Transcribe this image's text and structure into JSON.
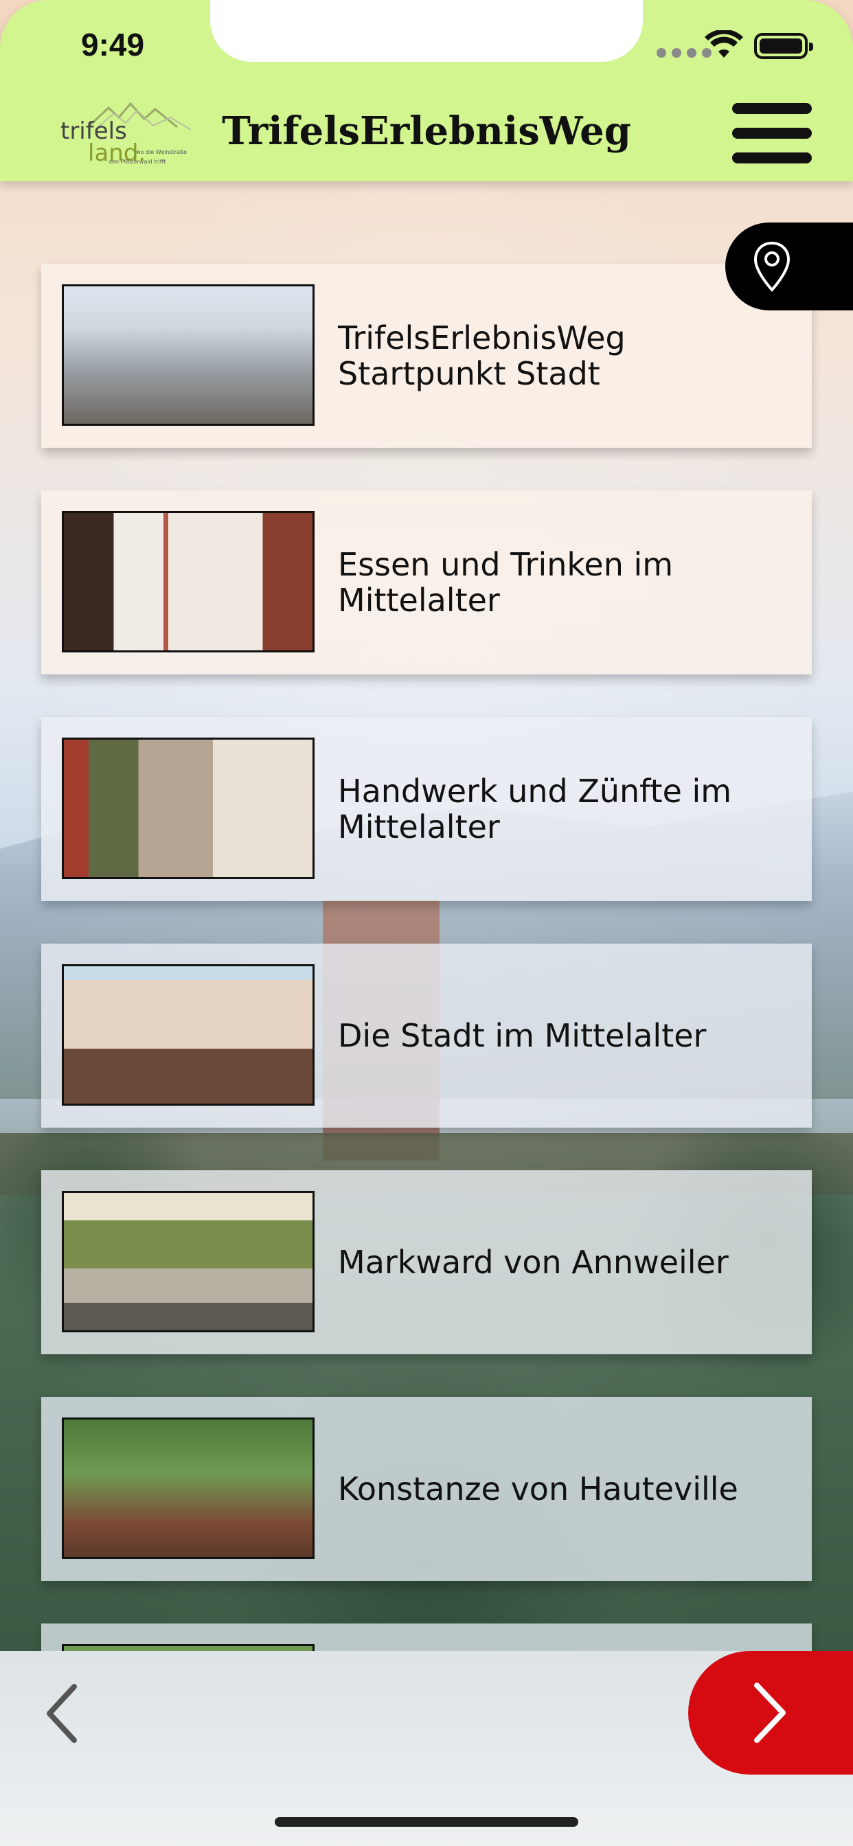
{
  "status_bar": {
    "time": "9:49",
    "icons": [
      "signal-dots-icon",
      "wifi-icon",
      "battery-icon"
    ]
  },
  "header": {
    "logo_text": "trifels land. wo die Weinstraße den Pfälzerwald trifft",
    "title": "TrifelsErlebnisWeg",
    "menu_icon": "hamburger-menu-icon",
    "background_color": "#d2f58f"
  },
  "map_button": {
    "icon": "location-pin-icon"
  },
  "stations": [
    {
      "title": "TrifelsErlebnisWeg\nStartpunkt Stadt"
    },
    {
      "title": "Essen und Trinken im\nMittelalter"
    },
    {
      "title": "Handwerk und Zünfte im\nMittelalter"
    },
    {
      "title": "Die Stadt im Mittelalter"
    },
    {
      "title": "Markward von Annweiler"
    },
    {
      "title": "Konstanze von Hauteville"
    }
  ],
  "bottom_bar": {
    "back_icon": "chevron-left-icon",
    "next_icon": "chevron-right-icon",
    "next_color": "#d60b12"
  }
}
